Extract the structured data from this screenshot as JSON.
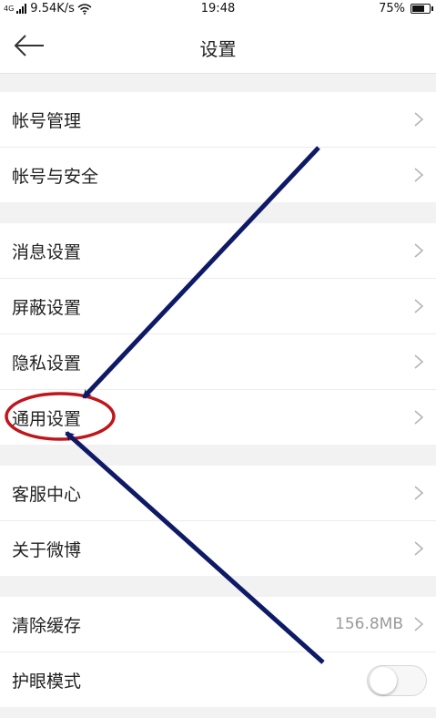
{
  "status_bar": {
    "network_type": "4G",
    "network_speed": "9.54K/s",
    "time": "19:48",
    "battery": "75%",
    "battery_level": 0.75,
    "icons": [
      "signal-icon",
      "wifi-icon",
      "battery-icon"
    ]
  },
  "header": {
    "title": "设置",
    "back_icon": "back-arrow-icon"
  },
  "groups": [
    {
      "items": [
        {
          "label": "帐号管理"
        },
        {
          "label": "帐号与安全"
        }
      ]
    },
    {
      "items": [
        {
          "label": "消息设置"
        },
        {
          "label": "屏蔽设置"
        },
        {
          "label": "隐私设置"
        },
        {
          "label": "通用设置"
        }
      ]
    },
    {
      "items": [
        {
          "label": "客服中心"
        },
        {
          "label": "关于微博"
        }
      ]
    },
    {
      "items": [
        {
          "label": "清除缓存",
          "value": "156.8MB"
        },
        {
          "label": "护眼模式",
          "toggle": false
        }
      ]
    }
  ],
  "annotation": {
    "highlighted_item": "通用设置",
    "circle_color": "#c0151b",
    "arrow_color": "#0f1a66"
  },
  "colors": {
    "page_bg": "#f2f2f2",
    "row_bg": "#ffffff",
    "text": "#222222",
    "chevron": "#b5b5b5",
    "secondary_text": "#9a9a9a"
  }
}
